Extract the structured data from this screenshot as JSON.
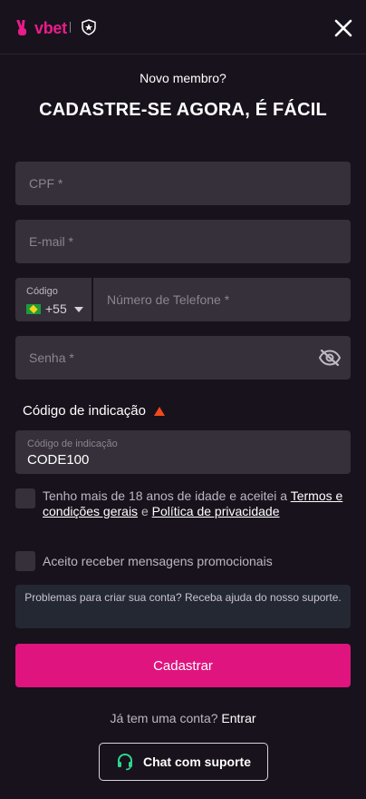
{
  "brand": {
    "logo_text": "vbet",
    "accent": "#e0147f"
  },
  "header": {
    "close_icon": "close-icon"
  },
  "form": {
    "subtitle": "Novo membro?",
    "title": "CADASTRE-SE AGORA, É FÁCIL",
    "cpf_placeholder": "CPF *",
    "email_placeholder": "E-mail *",
    "phone": {
      "code_label": "Código",
      "dial_code": "+55",
      "placeholder": "Número de Telefone *"
    },
    "password_placeholder": "Senha *",
    "referral": {
      "toggle_label": "Código de indicação",
      "field_label": "Código de indicação",
      "value": "CODE100"
    },
    "terms": {
      "prefix": "Tenho mais de 18 anos de idade e aceitei a",
      "terms_link": "Termos e condições gerais",
      "conjunction": "e",
      "privacy_link": "Política de privacidade"
    },
    "promo_label": "Aceito receber mensagens promocionais",
    "help_text": "Problemas para criar sua conta? Receba ajuda do nosso suporte.",
    "submit_label": "Cadastrar",
    "login_prompt": "Já tem uma conta?",
    "login_link": "Entrar",
    "chat_label": "Chat com suporte"
  }
}
